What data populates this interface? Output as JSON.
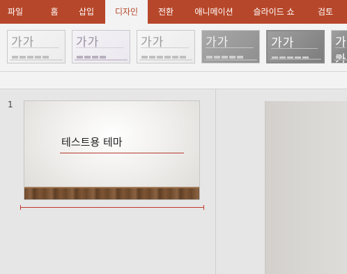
{
  "ribbon": {
    "tabs": [
      {
        "label": "파일",
        "active": false
      },
      {
        "label": "홈",
        "active": false
      },
      {
        "label": "삽입",
        "active": false
      },
      {
        "label": "디자인",
        "active": true
      },
      {
        "label": "전환",
        "active": false
      },
      {
        "label": "애니메이션",
        "active": false
      },
      {
        "label": "슬라이드 쇼",
        "active": false
      },
      {
        "label": "검토",
        "active": false
      }
    ],
    "accent_color": "#b7472a"
  },
  "themes": {
    "sample_text": "가가",
    "items": [
      {
        "style": "light"
      },
      {
        "style": "lavender"
      },
      {
        "style": "light"
      },
      {
        "style": "gray"
      },
      {
        "style": "dark"
      },
      {
        "style": "dark"
      }
    ]
  },
  "slides": [
    {
      "number": "1",
      "title": "테스트용 테마"
    }
  ],
  "colors": {
    "insert_line": "#c0392b",
    "title_underline": "#b23a2a"
  }
}
